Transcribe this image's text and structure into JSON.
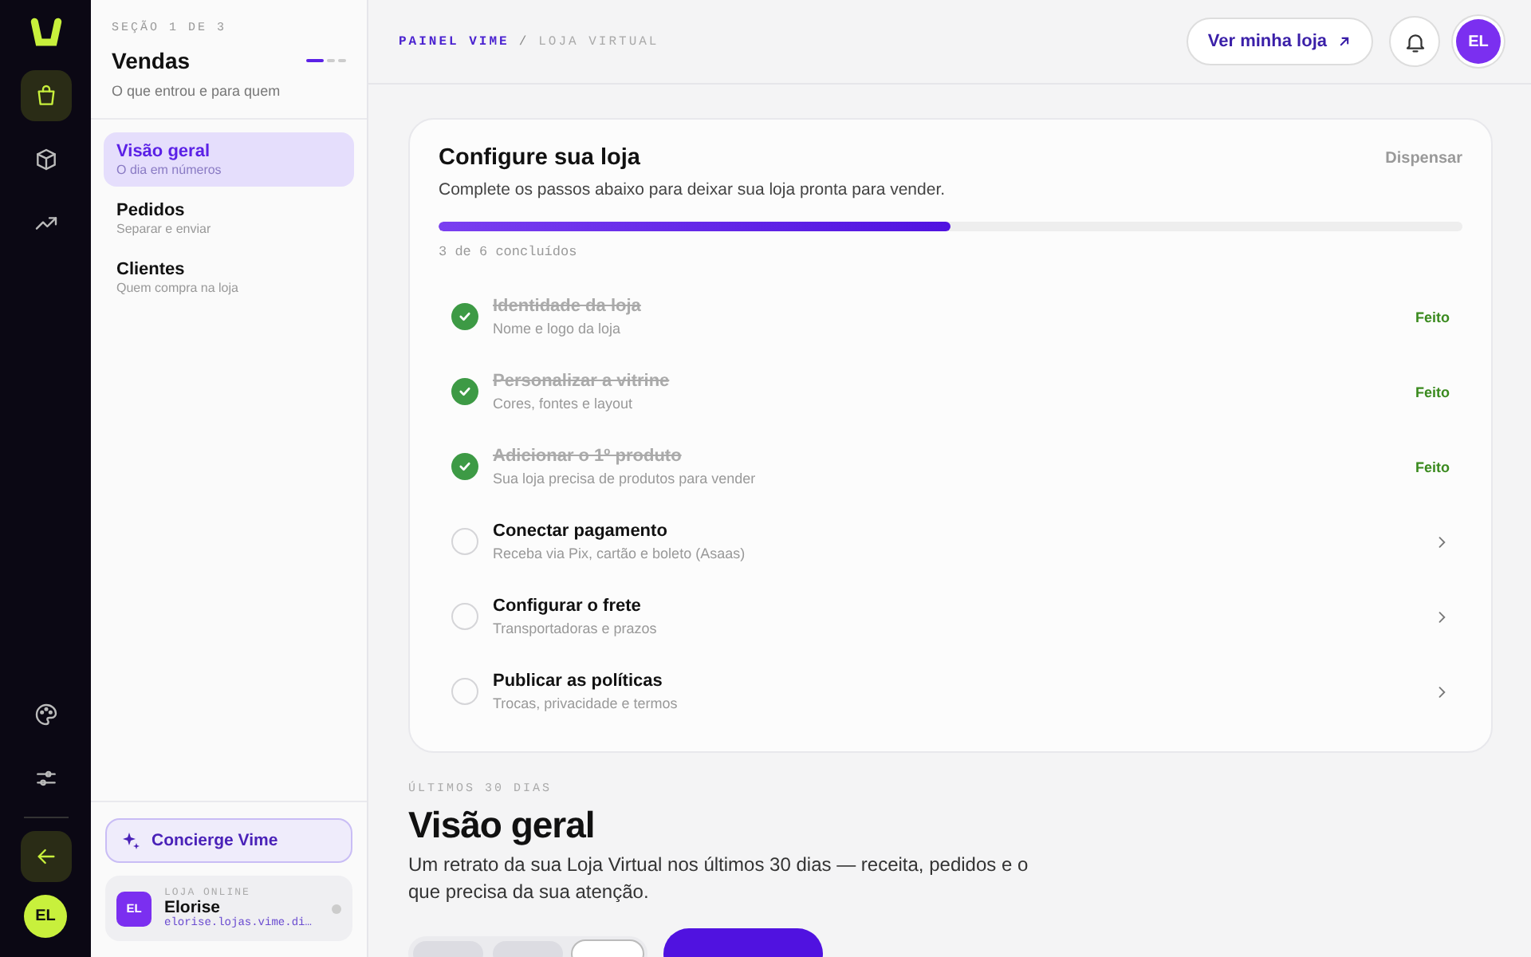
{
  "rail": {
    "items": [
      {
        "kind": "bag",
        "selected": true
      },
      {
        "kind": "box",
        "selected": false
      },
      {
        "kind": "trend",
        "selected": false
      }
    ],
    "bottom_items": [
      {
        "kind": "palette",
        "selected": false
      },
      {
        "kind": "sliders",
        "selected": false
      },
      {
        "kind": "back",
        "selected": true
      }
    ],
    "avatar": "EL"
  },
  "sidebar": {
    "section": "SEÇÃO 1 DE 3",
    "title": "Vendas",
    "subtitle": "O que entrou e para quem",
    "pager": [
      {
        "selected": true
      },
      {
        "selected": false
      },
      {
        "selected": false
      }
    ],
    "items": [
      {
        "label": "Visão geral",
        "caption": "O dia em números",
        "selected": true
      },
      {
        "label": "Pedidos",
        "caption": "Separar e enviar",
        "selected": false
      },
      {
        "label": "Clientes",
        "caption": "Quem compra na loja",
        "selected": false
      }
    ],
    "concierge": "Concierge Vime",
    "store": {
      "avatar": "EL",
      "kicker": "LOJA ONLINE",
      "name": "Elorise",
      "url": "elorise.lojas.vime.di…",
      "online": false
    }
  },
  "header": {
    "breadcrumb": [
      "PAINEL VIME",
      "/",
      "LOJA VIRTUAL"
    ],
    "store_button": "Ver minha loja",
    "avatar": "EL"
  },
  "setup": {
    "title": "Configure sua loja",
    "dismiss": "Dispensar",
    "description": "Complete os passos abaixo para deixar sua loja pronta para vender.",
    "level": 0.5,
    "progress_text": "3 de 6 concluídos",
    "steps": [
      {
        "title": "Identidade da loja",
        "caption": "Nome e logo da loja",
        "done": true,
        "status": "Feito"
      },
      {
        "title": "Personalizar a vitrine",
        "caption": "Cores, fontes e layout",
        "done": true,
        "status": "Feito"
      },
      {
        "title": "Adicionar o 1º produto",
        "caption": "Sua loja precisa de produtos para vender",
        "done": true,
        "status": "Feito"
      },
      {
        "title": "Conectar pagamento",
        "caption": "Receba via Pix, cartão e boleto (Asaas)",
        "done": false
      },
      {
        "title": "Configurar o frete",
        "caption": "Transportadoras e prazos",
        "done": false
      },
      {
        "title": "Publicar as políticas",
        "caption": "Trocas, privacidade e termos",
        "done": false
      }
    ]
  },
  "overview": {
    "kicker": "ÚLTIMOS 30 DIAS",
    "title": "Visão geral",
    "description": "Um retrato da sua Loja Virtual nos últimos 30 dias — receita, pedidos e o que precisa da sua atenção.",
    "periods": [
      {
        "selected": false
      },
      {
        "selected": false
      },
      {
        "selected": true
      }
    ]
  }
}
